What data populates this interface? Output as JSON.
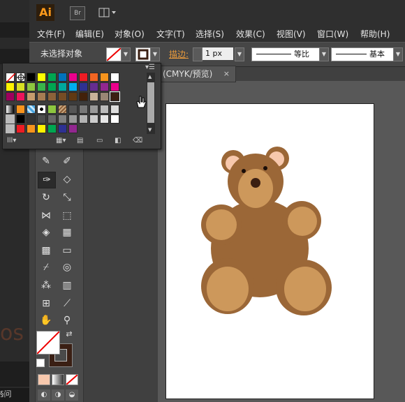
{
  "app": {
    "logo": "Ai",
    "bridge_label": "Br"
  },
  "menu": [
    "文件(F)",
    "编辑(E)",
    "对象(O)",
    "文字(T)",
    "选择(S)",
    "效果(C)",
    "视图(V)",
    "窗口(W)",
    "帮助(H)"
  ],
  "control": {
    "selection_status": "未选择对象",
    "stroke_label": "描边:",
    "stroke_weight": "1 px",
    "profile_left": "等比",
    "profile_right": "基本"
  },
  "document_tab": {
    "title": "(CMYK/预览)",
    "close_glyph": "×"
  },
  "desktop": {
    "bottom_text": "§问",
    "faded_text": "os"
  },
  "colors": {
    "bear_body": "#9b6737",
    "bear_light": "#cd985b",
    "bear_ear_inner": "#f7c8ad",
    "bear_dark": "#3b1f12"
  },
  "swatches": {
    "rows": [
      [
        "none",
        "registration",
        "#000000",
        "#ffff00",
        "#00a651",
        "#0072bc",
        "#ec008c",
        "#ed1c24",
        "#f26522",
        "#f7941d",
        "#ffffff"
      ],
      [
        "#fff200",
        "#d7df23",
        "#8dc63f",
        "#39b54a",
        "#00a651",
        "#00a99d",
        "#00aeef",
        "#2e3192",
        "#662d91",
        "#92278f",
        "#ec008c"
      ],
      [
        "#9e005d",
        "#ed145b",
        "#c69c6d",
        "#a67c52",
        "#8c6239",
        "#754c24",
        "#603913",
        "#42210b",
        "#c7b299",
        "#998675",
        "#3b1f12"
      ],
      [
        "gradient",
        "#f7941d",
        "pattern",
        "pattern2",
        "#8dc63f",
        "pattern3",
        "#555555",
        "#777777",
        "#999999",
        "#bbbbbb",
        "#dddddd"
      ],
      [
        "folder",
        "#000000",
        "#333333",
        "#4d4d4d",
        "#666666",
        "#808080",
        "#999999",
        "#b3b3b3",
        "#cccccc",
        "#e6e6e6",
        "#ffffff"
      ],
      [
        "folder",
        "#ed1c24",
        "#f7941d",
        "#fff200",
        "#00a651",
        "#2e3192",
        "#92278f"
      ]
    ]
  }
}
